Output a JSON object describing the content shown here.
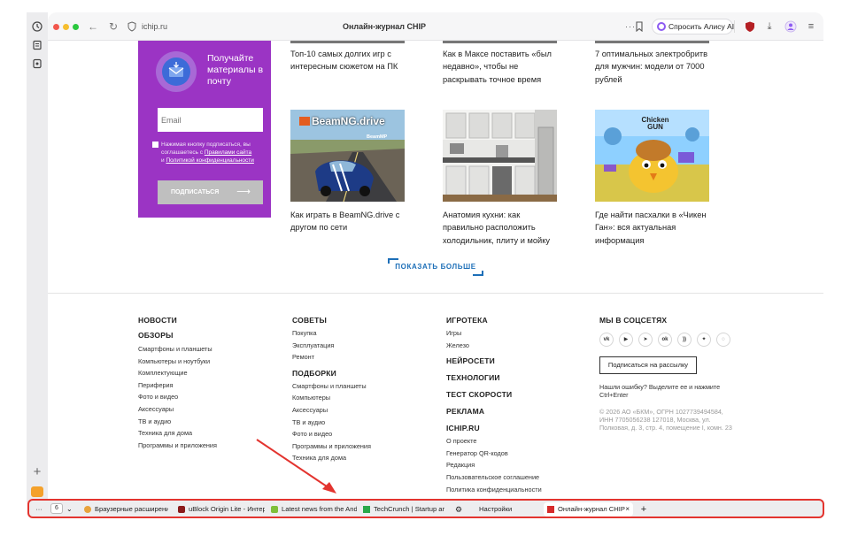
{
  "browser": {
    "url": "ichip.ru",
    "page_title": "Онлайн-журнал CHIP",
    "alisa_label": "Спросить Алису AI",
    "address_menu": "···"
  },
  "promo": {
    "title": "Получайте материалы в почту",
    "email_placeholder": "Email",
    "consent_prefix": "Нажимая кнопку подписаться, вы соглашаетесь с",
    "consent_link1": "Правилами сайта",
    "consent_and": "и",
    "consent_link2": "Политикой конфиденциальности",
    "submit_label": "ПОДПИСАТЬСЯ"
  },
  "articles_top": [
    {
      "title": "Топ-10 самых долгих игр с интересным сюжетом на ПК"
    },
    {
      "title": "Как в Максе поставить «был недавно», чтобы не раскрывать точное время"
    },
    {
      "title": "7 оптимальных электробритв для мужчин: модели от 7000 рублей"
    }
  ],
  "articles_bottom": [
    {
      "title": "Как играть в BeamNG.drive с другом по сети",
      "thumb_text": "BeamNG.drive",
      "thumb_sub": "BeamMP"
    },
    {
      "title": "Анатомия кухни: как правильно расположить холодильник, плиту и мойку"
    },
    {
      "title": "Где найти пасхалки в «Чикен Ган»: вся актуальная информация",
      "thumb_text": "Chicken GUN"
    }
  ],
  "show_more": "ПОКАЗАТЬ БОЛЬШЕ",
  "footer": {
    "col1": {
      "head1": "НОВОСТИ",
      "head2": "ОБЗОРЫ",
      "links": [
        "Смартфоны и планшеты",
        "Компьютеры и ноутбуки",
        "Комплектующие",
        "Периферия",
        "Фото и видео",
        "Аксессуары",
        "ТВ и аудио",
        "Техника для дома",
        "Программы и приложения"
      ]
    },
    "col2": {
      "head1": "СОВЕТЫ",
      "links1": [
        "Покупка",
        "Эксплуатация",
        "Ремонт"
      ],
      "head2": "ПОДБОРКИ",
      "links2": [
        "Смартфоны и планшеты",
        "Компьютеры",
        "Аксессуары",
        "ТВ и аудио",
        "Фото и видео",
        "Программы и приложения",
        "Техника для дома"
      ]
    },
    "col3": {
      "head1": "ИГРОТЕКА",
      "links1": [
        "Игры",
        "Железо"
      ],
      "head2": "НЕЙРОСЕТИ",
      "head3": "ТЕХНОЛОГИИ",
      "head4": "ТЕСТ СКОРОСТИ",
      "head5": "РЕКЛАМА",
      "head6": "ICHIP.RU",
      "links6": [
        "О проекте",
        "Генератор QR-кодов",
        "Редакция",
        "Пользовательское соглашение",
        "Политика конфиденциальности"
      ]
    },
    "col4": {
      "head": "МЫ В СОЦСЕТЯХ",
      "social": [
        "vk",
        "yt",
        "tg",
        "ok",
        "rss",
        "dzen",
        "max"
      ],
      "subscribe": "Подписаться на рассылку",
      "error_note": "Нашли ошибку? Выделите ее и нажмите Ctrl+Enter",
      "copyright": "© 2026 АО «БКМ», ОГРН 1027739494584, ИНН 7705056238 127018, Москва, ул. Полковая, д. 3, стр. 4, помещение I, комн. 23"
    }
  },
  "tabbar": {
    "menu": "···",
    "count": "6",
    "tabs": [
      {
        "label": "Браузерные расширени",
        "favicon": "chrome-icon",
        "color": "#e8a33c"
      },
      {
        "label": "uBlock Origin Lite - Интер",
        "favicon": "ublock-icon",
        "color": "#8b1a1a"
      },
      {
        "label": "Latest news from the Andr",
        "favicon": "android-icon",
        "color": "#7fbf3a"
      },
      {
        "label": "TechCrunch | Startup and",
        "favicon": "techcrunch-icon",
        "color": "#2aa84a"
      },
      {
        "label": "",
        "favicon": "gear-icon",
        "color": "#333333"
      },
      {
        "label": "Настройки",
        "favicon": "",
        "color": ""
      },
      {
        "label": "Онлайн-журнал CHIP",
        "favicon": "chip-icon",
        "color": "#d62b2b"
      }
    ],
    "new_tab": "+"
  },
  "colors": {
    "promo": "#9b34c4",
    "accent": "#1d6fb8",
    "highlight": "#e3342f"
  }
}
